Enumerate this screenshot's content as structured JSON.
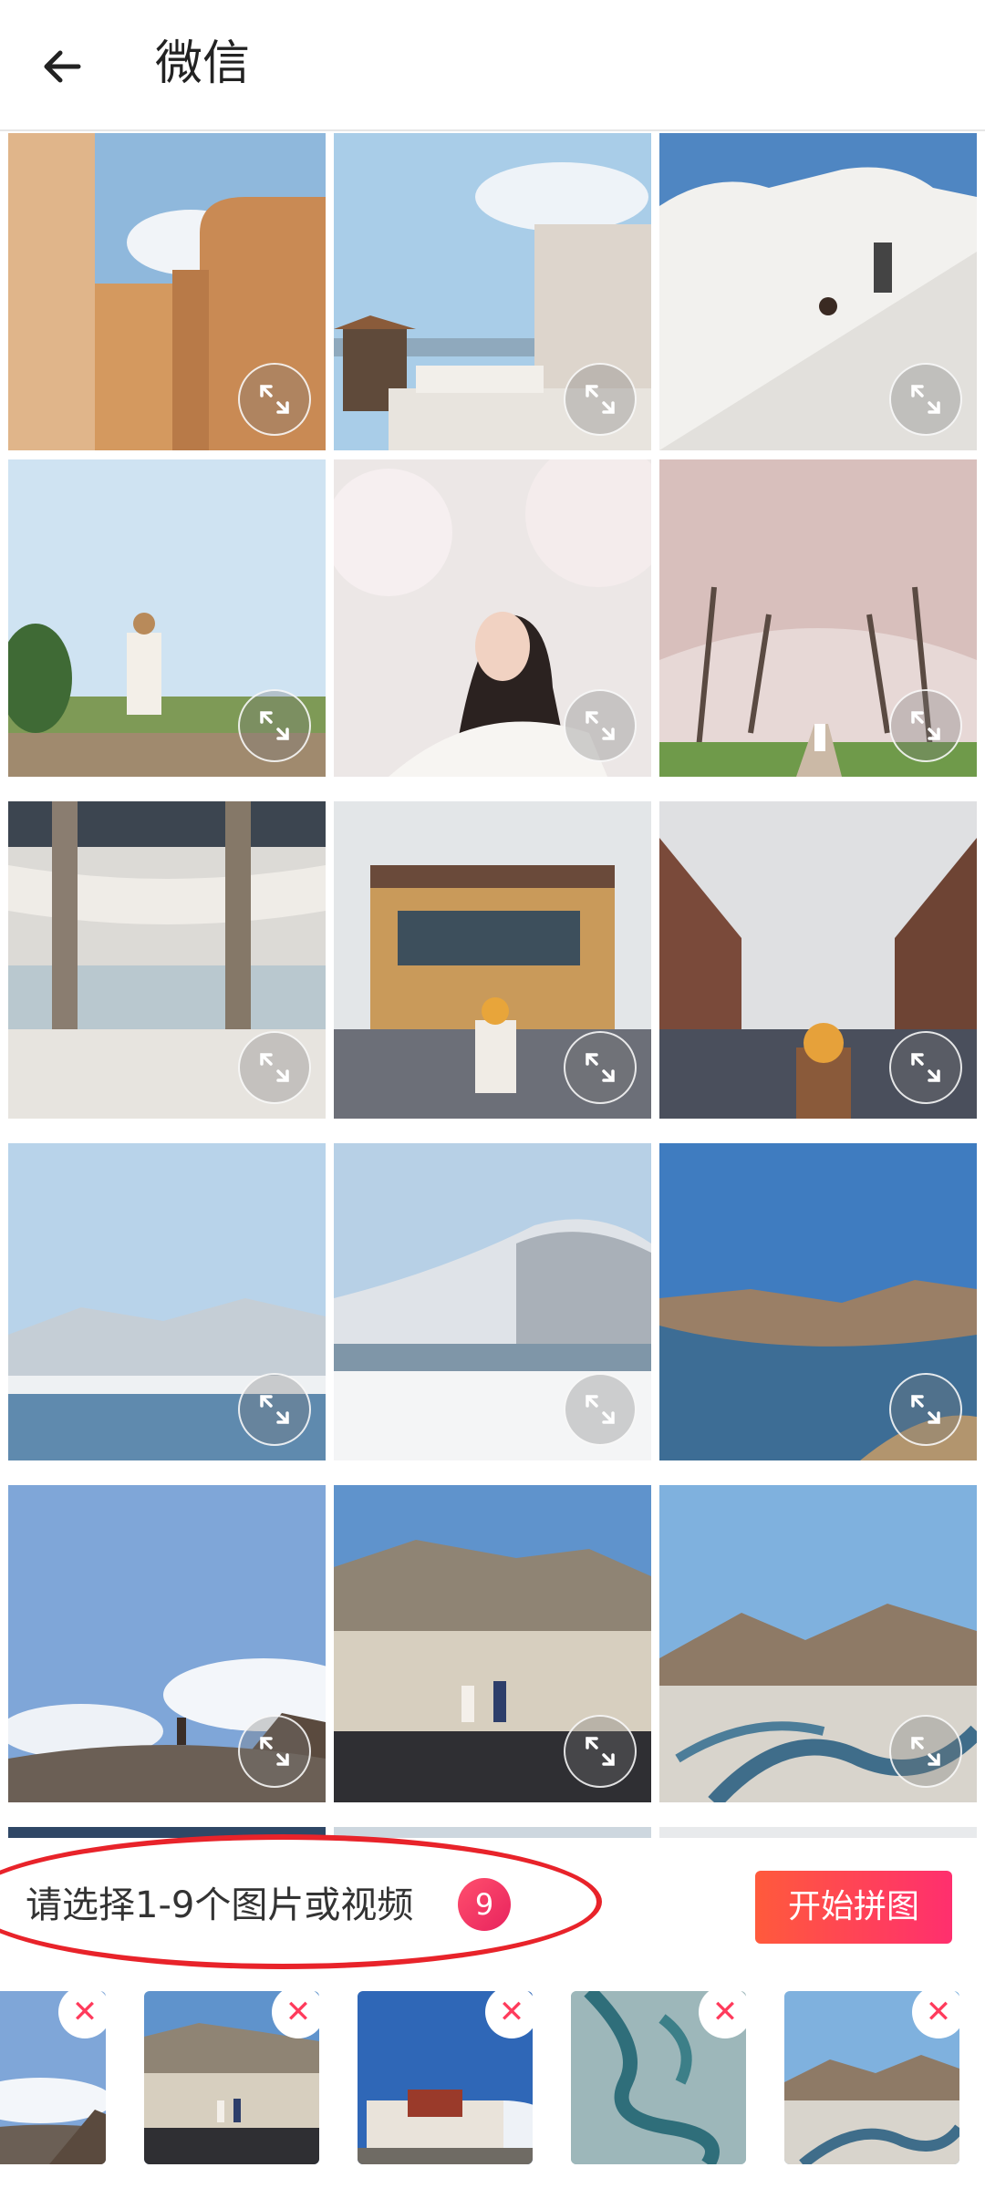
{
  "header": {
    "title": "微信",
    "back_icon": "arrow-left-icon"
  },
  "grid": {
    "photos": [
      {
        "name": "photo-desert-architecture"
      },
      {
        "name": "photo-white-rooftop-terrace"
      },
      {
        "name": "photo-white-staircase-building"
      },
      {
        "name": "photo-woman-in-grass-field"
      },
      {
        "name": "photo-woman-cherry-blossoms"
      },
      {
        "name": "photo-cherry-blossom-path"
      },
      {
        "name": "photo-curved-building-pillars"
      },
      {
        "name": "photo-tibetan-building-crowd"
      },
      {
        "name": "photo-tibetan-street-crowd"
      },
      {
        "name": "photo-snowy-lake-mountains"
      },
      {
        "name": "photo-snowy-mountain-shore"
      },
      {
        "name": "photo-blue-lake-valley"
      },
      {
        "name": "photo-person-on-dunes"
      },
      {
        "name": "photo-couple-riverbank"
      },
      {
        "name": "photo-aerial-river-valley"
      }
    ],
    "expand_icon": "expand-arrows-icon"
  },
  "bottom": {
    "prompt": "请选择1-9个图片或视频",
    "count": "9",
    "start_button": "开始拼图",
    "accent_color": "#ff2f6e",
    "remove_symbol": "✕",
    "selected": [
      {
        "name": "selected-person-on-dunes"
      },
      {
        "name": "selected-couple-riverbank"
      },
      {
        "name": "selected-potala-palace"
      },
      {
        "name": "selected-winding-road-aerial"
      },
      {
        "name": "selected-aerial-river-valley"
      }
    ]
  }
}
